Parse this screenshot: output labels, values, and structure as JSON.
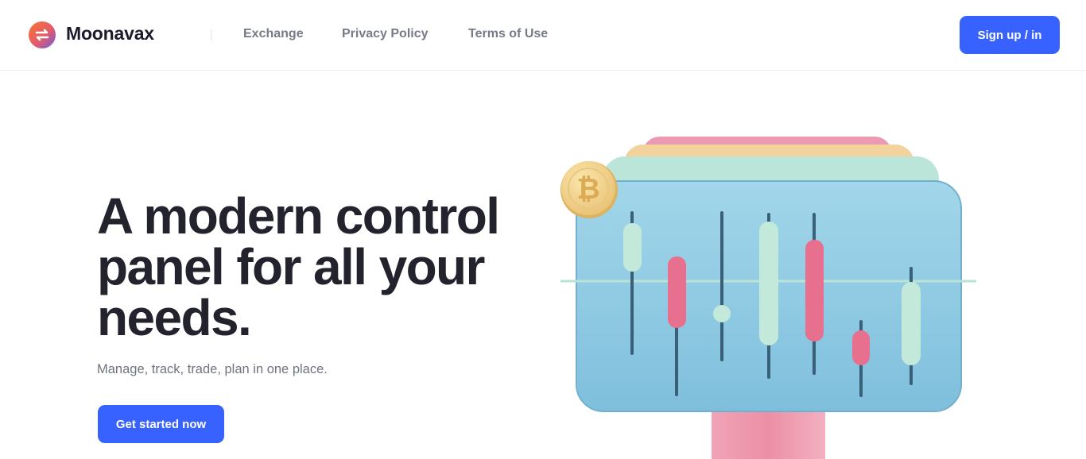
{
  "brand": {
    "name": "Moonavax",
    "logo_icon": "swap-arrows-icon",
    "logo_gradient": [
      "#f26a3c",
      "#7b5bd8"
    ]
  },
  "nav": {
    "links": [
      "Exchange",
      "Privacy Policy",
      "Terms of Use"
    ],
    "signup_label": "Sign up / in"
  },
  "hero": {
    "title_lines": [
      "A modern control",
      "panel for all your",
      "needs."
    ],
    "subtitle": "Manage, track, trade, plan in one place.",
    "cta_label": "Get started now"
  },
  "illustration": {
    "icon": "candlestick-chart-icon",
    "coin_icon": "bitcoin-icon",
    "coin_symbol": "₿"
  },
  "colors": {
    "accent": "#3862ff",
    "text_dark": "#23232e",
    "text_muted": "#6f7380",
    "nav_text": "#777b86",
    "panel_blue": "#8ecbe4",
    "candle_green": "#bfe8d8",
    "candle_pink": "#e9708f",
    "coin_gold": "#f2d58a"
  }
}
